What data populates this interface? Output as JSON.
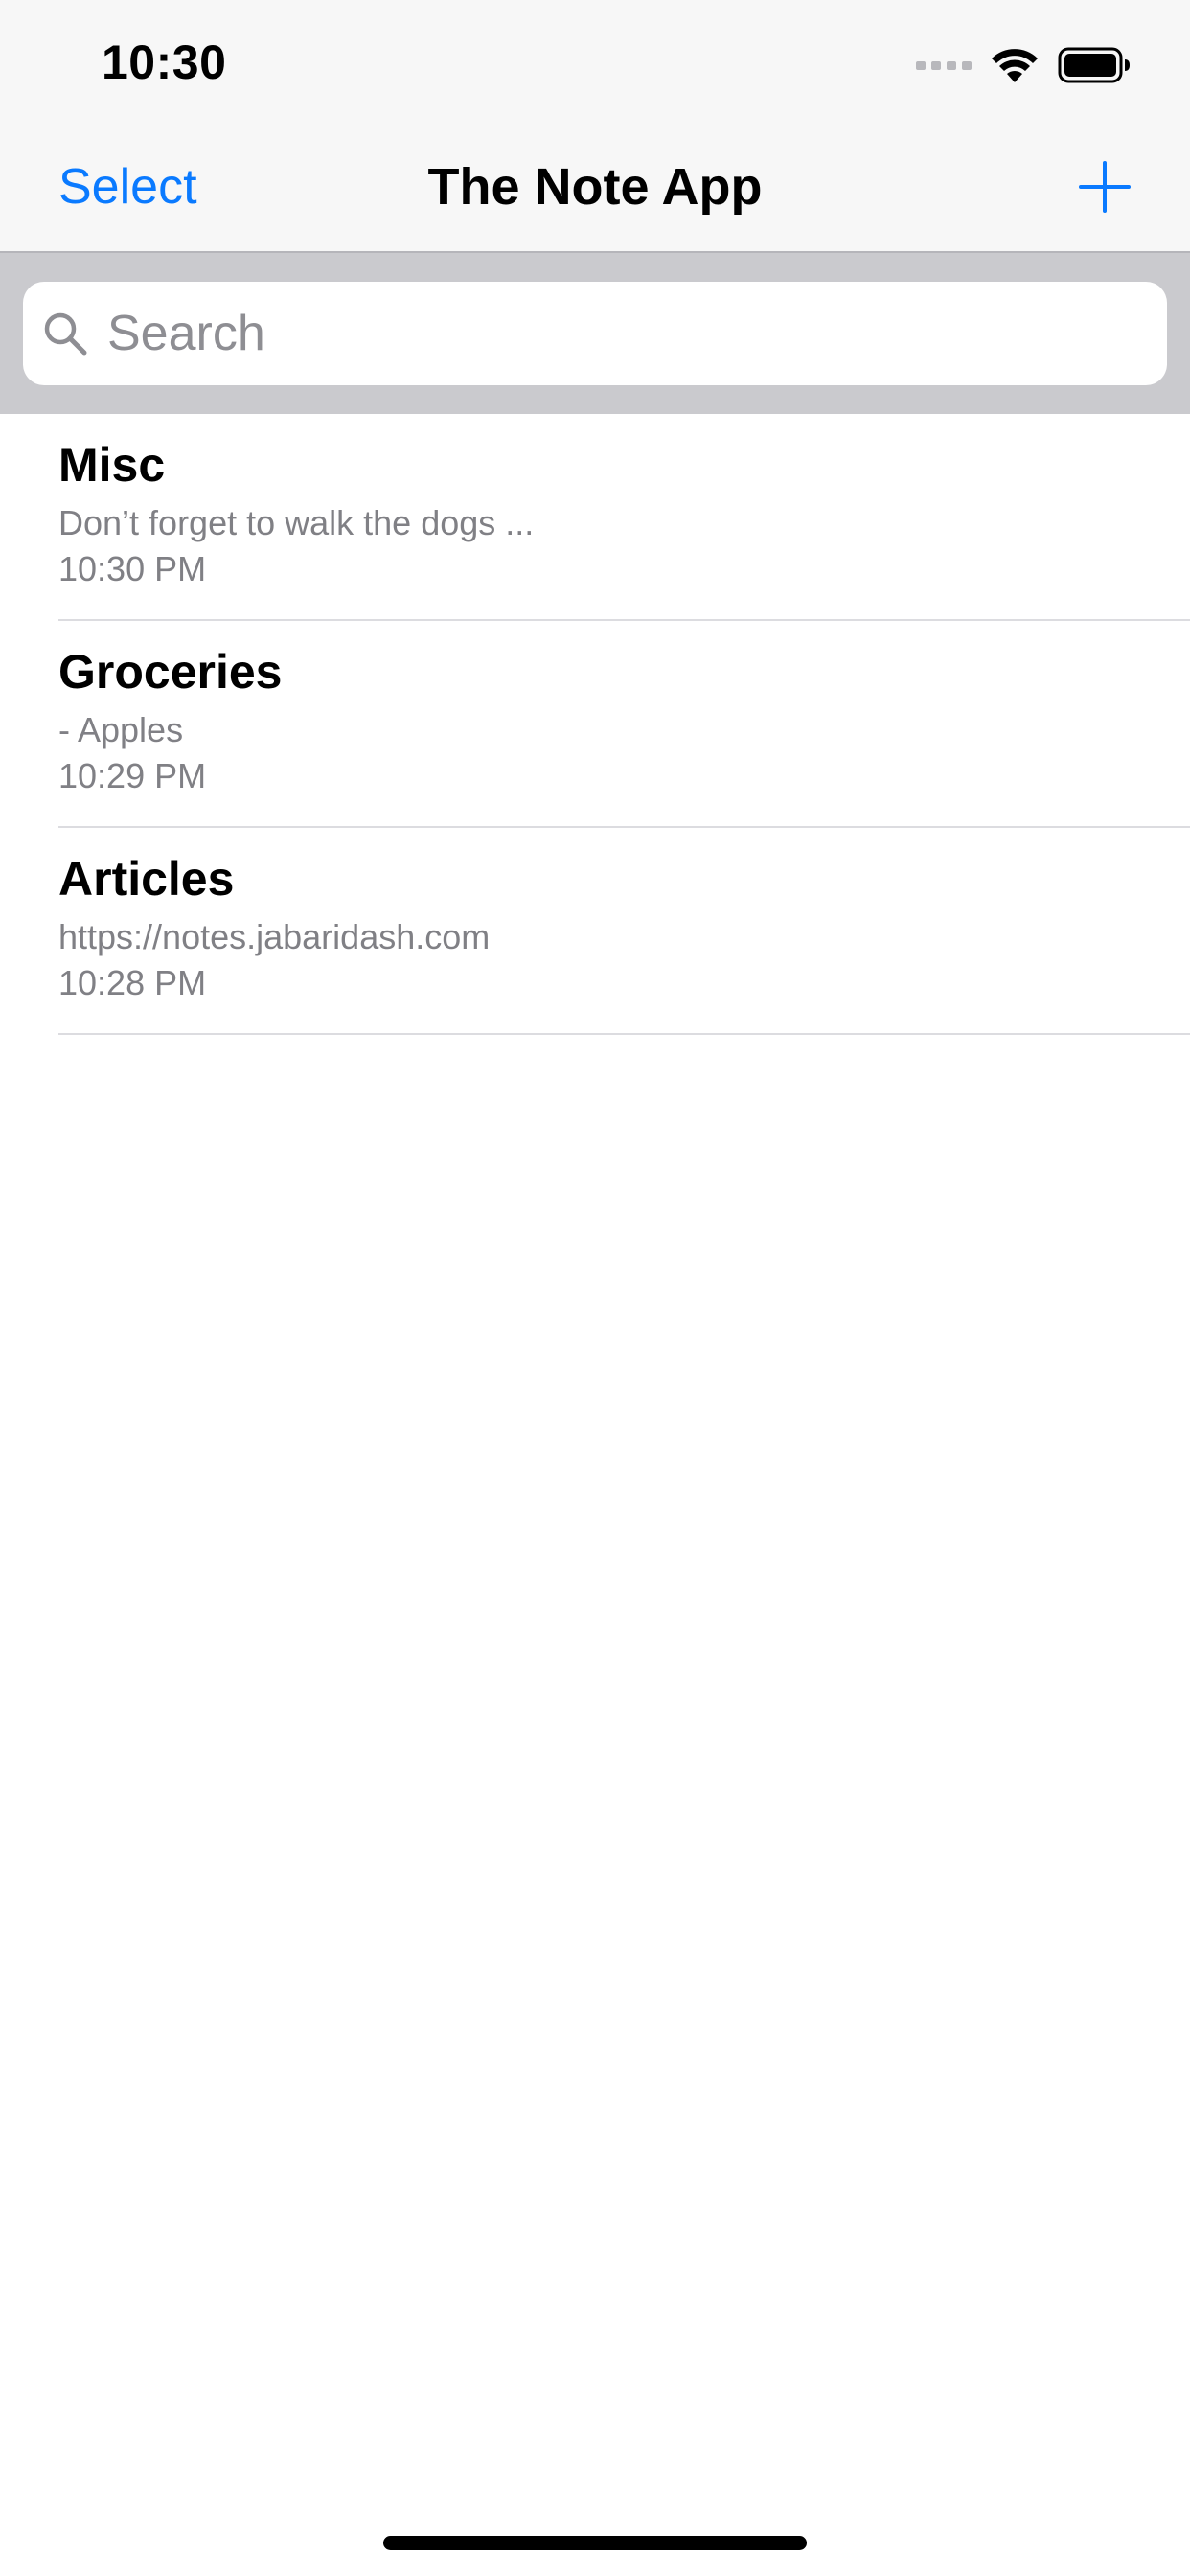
{
  "status_bar": {
    "time": "10:30",
    "icons": [
      "cellular-signal-icon",
      "wifi-icon",
      "battery-icon"
    ]
  },
  "nav_bar": {
    "select_label": "Select",
    "title": "The Note App",
    "add_icon": "plus-icon"
  },
  "search": {
    "placeholder": "Search",
    "value": "",
    "icon": "search-icon"
  },
  "notes": [
    {
      "title": "Misc",
      "preview": "Don’t forget to walk the dogs ...",
      "time": "10:30 PM"
    },
    {
      "title": "Groceries",
      "preview": "- Apples",
      "time": "10:29 PM"
    },
    {
      "title": "Articles",
      "preview": "https://notes.jabaridash.com",
      "time": "10:28 PM"
    }
  ],
  "colors": {
    "accent": "#0a7aff",
    "bar_background": "#f7f7f7",
    "search_background": "#cacace",
    "secondary_text": "#808085"
  }
}
